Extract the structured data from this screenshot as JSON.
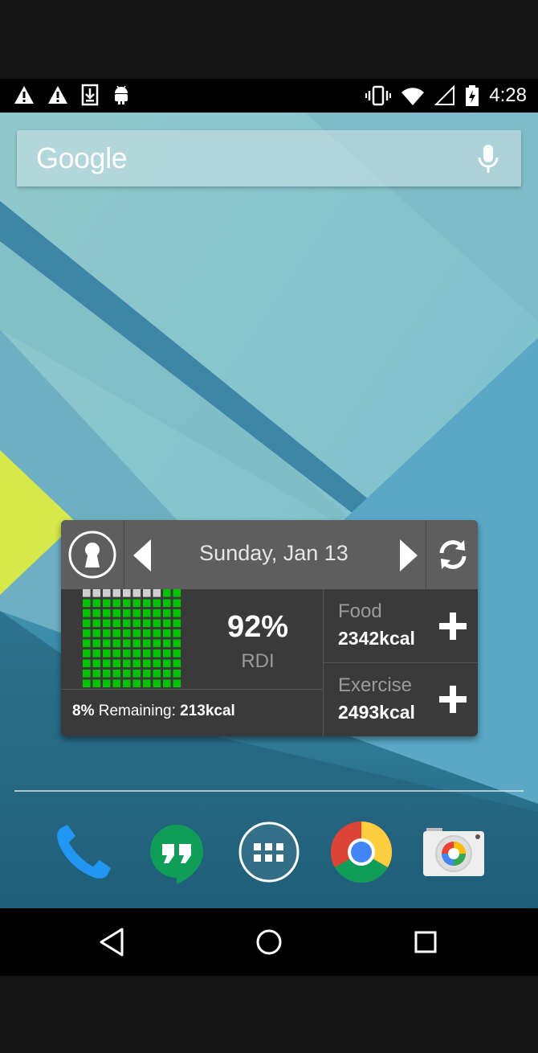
{
  "statusbar": {
    "time": "4:28",
    "left_icons": [
      "warning-icon",
      "warning-icon",
      "download-icon",
      "android-icon"
    ],
    "right_icons": [
      "vibrate-icon",
      "wifi-icon",
      "signal-icon",
      "battery-charging-icon"
    ]
  },
  "search": {
    "logo_text": "Google"
  },
  "widget": {
    "date": "Sunday, Jan 13",
    "percent": "92%",
    "rdi_label": "RDI",
    "remaining_pct": "8%",
    "remaining_label": " Remaining: ",
    "remaining_kcal": "213kcal",
    "food_label": "Food",
    "food_value": "2342kcal",
    "exercise_label": "Exercise",
    "exercise_value": "2493kcal",
    "progress_fraction": 0.92,
    "colors": {
      "filled": "#00c400",
      "empty": "#cfcfcf",
      "header": "#5e5e5e",
      "body": "#3a3a3a"
    }
  },
  "dock": {
    "apps": [
      "phone-icon",
      "hangouts-icon",
      "app-drawer-icon",
      "chrome-icon",
      "camera-icon"
    ]
  },
  "navbar": {
    "buttons": [
      "back-icon",
      "home-icon",
      "recents-icon"
    ]
  }
}
